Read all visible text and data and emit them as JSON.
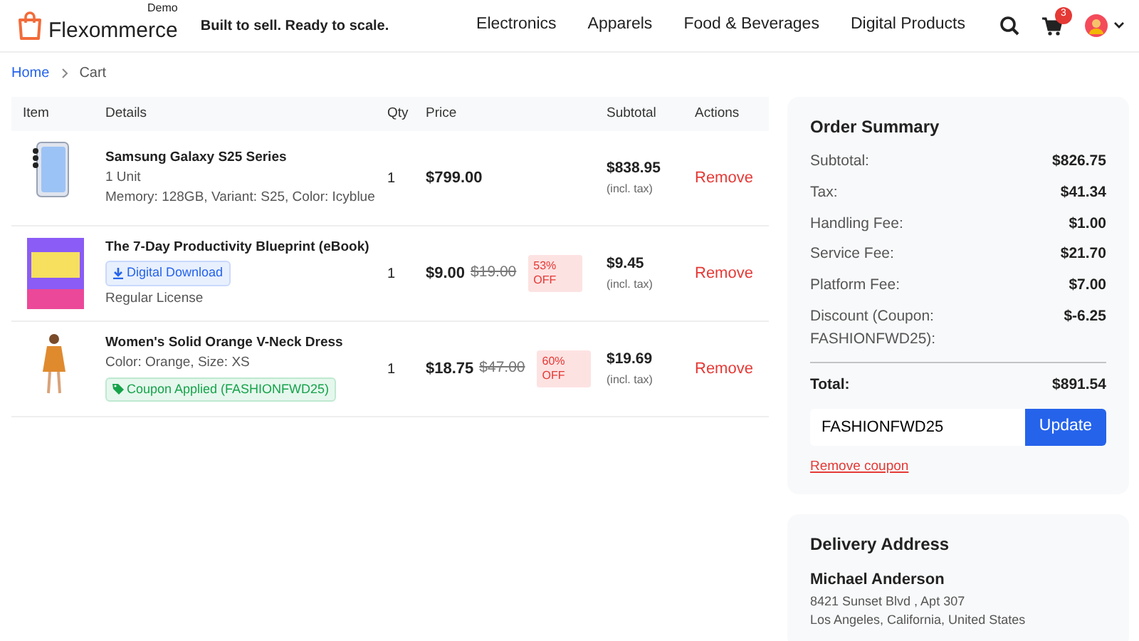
{
  "header": {
    "logo_text": "Flexommerce",
    "logo_badge": "Demo",
    "tagline": "Built to sell. Ready to scale.",
    "nav_links": [
      "Electronics",
      "Apparels",
      "Food & Beverages",
      "Digital Products"
    ],
    "cart_count": "3"
  },
  "breadcrumb": [
    "Home",
    "Cart"
  ],
  "cart": {
    "columns": [
      "Item",
      "Details",
      "Qty",
      "Price",
      "Subtotal",
      "Actions"
    ],
    "rows": [
      {
        "name": "Samsung Galaxy S25 Series",
        "details": [
          {
            "kind": "text",
            "text": "1 Unit"
          },
          {
            "kind": "text",
            "text": "Memory: 128GB, Variant: S25, Color: Icyblue"
          }
        ],
        "qty": "1",
        "price": "$799.00",
        "subtotal": "$838.95",
        "subtotal_note": "(incl. tax)",
        "action": "Remove"
      },
      {
        "name": "The 7-Day Productivity Blueprint (eBook)",
        "details": [
          {
            "kind": "download",
            "text": "Digital Download"
          },
          {
            "kind": "text",
            "text": "Regular License"
          }
        ],
        "qty": "1",
        "price": "$9.00",
        "original_price": "$19.00",
        "discount": "53% OFF",
        "subtotal": "$9.45",
        "subtotal_note": "(incl. tax)",
        "action": "Remove"
      },
      {
        "name": "Women's Solid Orange V-Neck Dress",
        "details": [
          {
            "kind": "text",
            "text": "Color: Orange, Size: XS"
          },
          {
            "kind": "coupon",
            "text": "Coupon Applied (FASHIONFWD25)"
          }
        ],
        "qty": "1",
        "price": "$18.75",
        "original_price": "$47.00",
        "discount": "60% OFF",
        "subtotal": "$19.69",
        "subtotal_note": "(incl. tax)",
        "action": "Remove"
      }
    ]
  },
  "summary": {
    "title": "Order Summary",
    "lines": [
      {
        "label": "Subtotal:",
        "value": "$826.75"
      },
      {
        "label": "Tax:",
        "value": "$41.34"
      },
      {
        "label": "Handling Fee:",
        "value": "$1.00"
      },
      {
        "label": "Service Fee:",
        "value": "$21.70"
      },
      {
        "label": "Platform Fee:",
        "value": "$7.00"
      },
      {
        "label": "Discount (Coupon: FASHIONFWD25):",
        "value": "$-6.25"
      }
    ],
    "total": {
      "label": "Total:",
      "value": "$891.54"
    },
    "coupon": {
      "value": "FASHIONFWD25",
      "button": "Update"
    },
    "remove_link": "Remove coupon"
  },
  "address": {
    "title": "Delivery Address",
    "name": "Michael Anderson",
    "lines": [
      "8421 Sunset Blvd , Apt 307",
      "Los Angeles, California, United States"
    ]
  }
}
